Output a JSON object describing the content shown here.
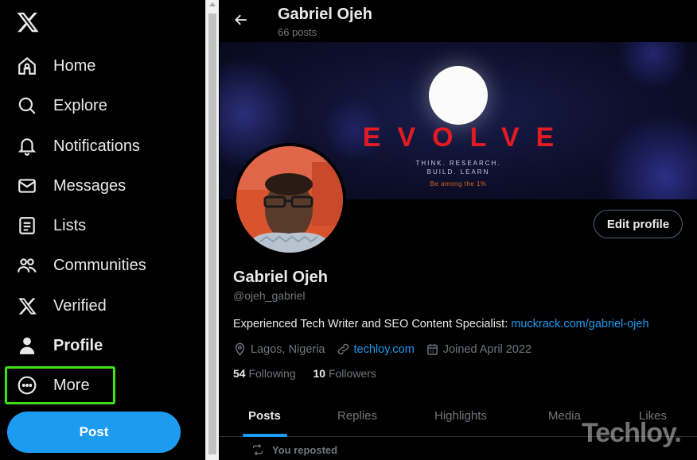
{
  "sidebar": {
    "logo": "x-logo-icon",
    "items": [
      {
        "label": "Home",
        "icon": "home-icon"
      },
      {
        "label": "Explore",
        "icon": "search-icon"
      },
      {
        "label": "Notifications",
        "icon": "bell-icon"
      },
      {
        "label": "Messages",
        "icon": "envelope-icon"
      },
      {
        "label": "Lists",
        "icon": "list-icon"
      },
      {
        "label": "Communities",
        "icon": "people-icon"
      },
      {
        "label": "Verified",
        "icon": "x-logo-icon"
      },
      {
        "label": "Profile",
        "icon": "person-icon"
      },
      {
        "label": "More",
        "icon": "more-circle-icon"
      }
    ],
    "post_label": "Post",
    "highlight_color": "#3de21d"
  },
  "header": {
    "name": "Gabriel Ojeh",
    "posts": "66 posts"
  },
  "banner": {
    "word": "EVOLVE",
    "tagline_1": "THINK. RESEARCH.",
    "tagline_2": "BUILD. LEARN",
    "cta": "Be among the 1%"
  },
  "profile": {
    "edit_label": "Edit profile",
    "name": "Gabriel Ojeh",
    "handle": "@ojeh_gabriel",
    "bio_text": "Experienced Tech Writer and SEO Content Specialist: ",
    "bio_link": "muckrack.com/gabriel-ojeh",
    "location": "Lagos, Nigeria",
    "website": "techloy.com",
    "joined": "Joined April 2022",
    "following_count": "54",
    "following_label": "Following",
    "followers_count": "10",
    "followers_label": "Followers"
  },
  "tabs": [
    "Posts",
    "Replies",
    "Highlights",
    "Media",
    "Likes"
  ],
  "feed": {
    "repost_label": "You reposted"
  },
  "watermark": "Techloy.",
  "colors": {
    "accent": "#1d9bf0",
    "text": "#e7e9ea",
    "muted": "#71767b",
    "evolve_red": "#e31b23"
  }
}
